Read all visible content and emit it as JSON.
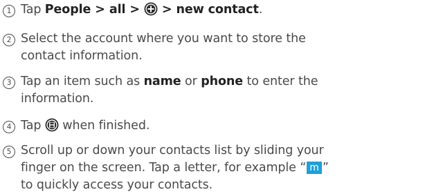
{
  "steps": [
    {
      "number": "1",
      "lines": [
        {
          "parts": [
            {
              "text": "Tap ",
              "bold": false
            },
            {
              "text": "People > all > ",
              "bold": true
            },
            {
              "icon": "add-circle-icon"
            },
            {
              "text": " > new contact",
              "bold": true
            },
            {
              "text": ".",
              "bold": false
            }
          ]
        }
      ]
    },
    {
      "number": "2",
      "lines": [
        {
          "parts": [
            {
              "text": "Select the account where you want to store the",
              "bold": false
            }
          ]
        },
        {
          "parts": [
            {
              "text": "contact information.",
              "bold": false
            }
          ]
        }
      ]
    },
    {
      "number": "3",
      "lines": [
        {
          "parts": [
            {
              "text": "Tap an item such as ",
              "bold": false
            },
            {
              "text": "name",
              "bold": true
            },
            {
              "text": " or ",
              "bold": false
            },
            {
              "text": "phone",
              "bold": true
            },
            {
              "text": " to enter the",
              "bold": false
            }
          ]
        },
        {
          "parts": [
            {
              "text": "information.",
              "bold": false
            }
          ]
        }
      ]
    },
    {
      "number": "4",
      "lines": [
        {
          "parts": [
            {
              "text": "Tap ",
              "bold": false
            },
            {
              "icon": "save-disk-icon"
            },
            {
              "text": " when finished.",
              "bold": false
            }
          ]
        }
      ]
    },
    {
      "number": "5",
      "lines": [
        {
          "parts": [
            {
              "text": "Scroll up or down your contacts list by sliding your",
              "bold": false
            }
          ]
        },
        {
          "parts": [
            {
              "text": "finger on the screen. Tap a letter, for example “",
              "bold": false
            },
            {
              "letterbox": "m"
            },
            {
              "text": "”",
              "bold": false
            }
          ]
        },
        {
          "parts": [
            {
              "text": "to quickly access your contacts.",
              "bold": false
            }
          ]
        }
      ]
    }
  ],
  "colors": {
    "text": "#4a4a4a",
    "bold_text": "#222222",
    "icon_fill": "#2b2b2b",
    "letter_box": "#1fa0d8"
  }
}
